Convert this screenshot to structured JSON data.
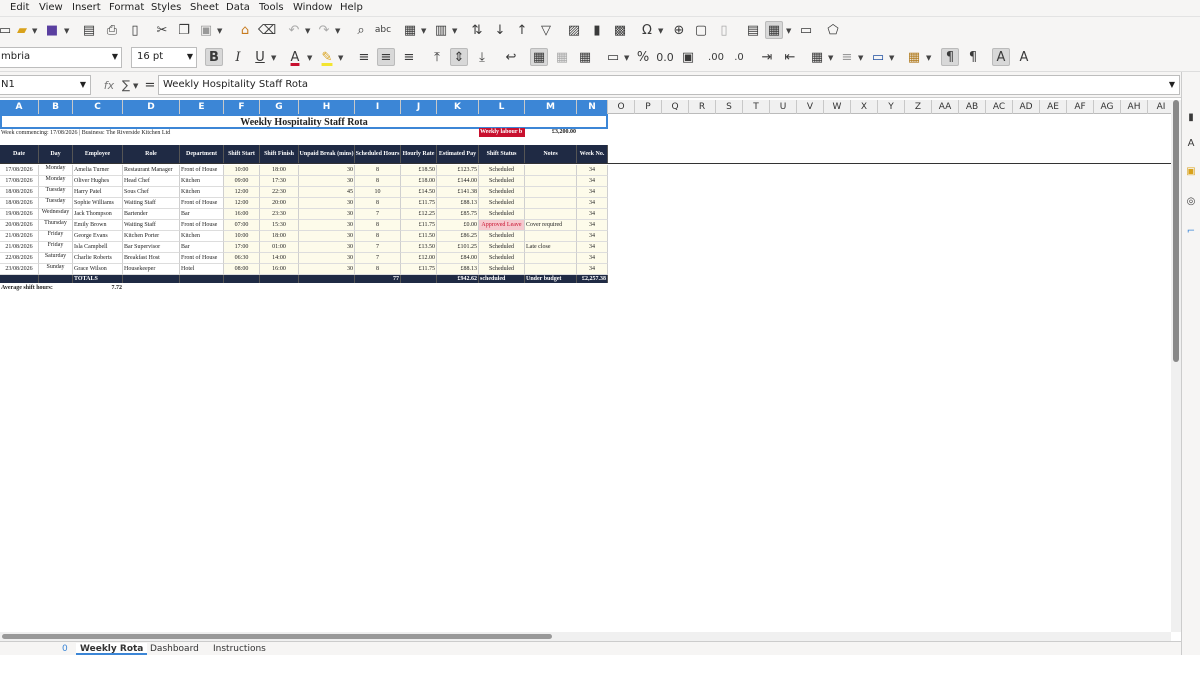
{
  "menu": [
    "Edit",
    "View",
    "Insert",
    "Format",
    "Styles",
    "Sheet",
    "Data",
    "Tools",
    "Window",
    "Help"
  ],
  "font": {
    "name": "mbria",
    "size": "16 pt"
  },
  "namebox": "N1",
  "formula_symbols": {
    "fx": "fx",
    "sigma": "∑",
    "eq": "="
  },
  "formula": "Weekly Hospitality Staff Rota",
  "columns": [
    "A",
    "B",
    "C",
    "D",
    "E",
    "F",
    "G",
    "H",
    "I",
    "J",
    "K",
    "L",
    "M",
    "N",
    "O",
    "P",
    "Q",
    "R",
    "S",
    "T",
    "U",
    "V",
    "W",
    "X",
    "Y",
    "Z",
    "AA",
    "AB",
    "AC",
    "AD",
    "AE",
    "AF",
    "AG",
    "AH",
    "AI"
  ],
  "rota": {
    "title": "Weekly Hospitality Staff Rota",
    "subtitle": "Week commencing: 17/08/2026 | Business: The Riverside Kitchen Ltd",
    "labour_label": "Weekly labour b",
    "labour_value": "£3,200.00",
    "headers": [
      "Date",
      "Day",
      "Employee",
      "Role",
      "Department",
      "Shift Start",
      "Shift Finish",
      "Unpaid Break (mins)",
      "Scheduled Hours",
      "Hourly Rate",
      "Estimated Pay",
      "Shift Status",
      "Notes",
      "Week No."
    ],
    "rows": [
      [
        "17/08/2026",
        "Monday",
        "Amelia Turner",
        "Restaurant Manager",
        "Front of House",
        "10:00",
        "18:00",
        "30",
        "8",
        "£18.50",
        "£123.75",
        "Scheduled",
        "",
        "34"
      ],
      [
        "17/08/2026",
        "Monday",
        "Oliver Hughes",
        "Head Chef",
        "Kitchen",
        "09:00",
        "17:30",
        "30",
        "8",
        "£18.00",
        "£144.00",
        "Scheduled",
        "",
        "34"
      ],
      [
        "18/08/2026",
        "Tuesday",
        "Harry Patel",
        "Sous Chef",
        "Kitchen",
        "12:00",
        "22:30",
        "45",
        "10",
        "£14.50",
        "£141.38",
        "Scheduled",
        "",
        "34"
      ],
      [
        "18/08/2026",
        "Tuesday",
        "Sophie Williams",
        "Waiting Staff",
        "Front of House",
        "12:00",
        "20:00",
        "30",
        "8",
        "£11.75",
        "£88.13",
        "Scheduled",
        "",
        "34"
      ],
      [
        "19/08/2026",
        "Wednesday",
        "Jack Thompson",
        "Bartender",
        "Bar",
        "16:00",
        "23:30",
        "30",
        "7",
        "£12.25",
        "£85.75",
        "Scheduled",
        "",
        "34"
      ],
      [
        "20/08/2026",
        "Thursday",
        "Emily Brown",
        "Waiting Staff",
        "Front of House",
        "07:00",
        "15:30",
        "30",
        "8",
        "£11.75",
        "£0.00",
        "Approved Leave",
        "Cover required",
        "34"
      ],
      [
        "21/08/2026",
        "Friday",
        "George Evans",
        "Kitchen Porter",
        "Kitchen",
        "10:00",
        "18:00",
        "30",
        "8",
        "£11.50",
        "£86.25",
        "Scheduled",
        "",
        "34"
      ],
      [
        "21/08/2026",
        "Friday",
        "Isla Campbell",
        "Bar Supervisor",
        "Bar",
        "17:00",
        "01:00",
        "30",
        "7",
        "£13.50",
        "£101.25",
        "Scheduled",
        "Late close",
        "34"
      ],
      [
        "22/08/2026",
        "Saturday",
        "Charlie Roberts",
        "Breakfast Host",
        "Front of House",
        "06:30",
        "14:00",
        "30",
        "7",
        "£12.00",
        "£84.00",
        "Scheduled",
        "",
        "34"
      ],
      [
        "23/08/2026",
        "Sunday",
        "Grace Wilson",
        "Housekeeper",
        "Hotel",
        "08:00",
        "16:00",
        "30",
        "8",
        "£11.75",
        "£88.13",
        "Scheduled",
        "",
        "34"
      ]
    ],
    "totals": {
      "label": "TOTALS",
      "hours": "77",
      "pay": "£942.62",
      "status": "scheduled",
      "notes": "Under budget",
      "week": "£2,257.38"
    },
    "avg_label": "Average shift hours:",
    "avg_value": "7.72"
  },
  "tabs": [
    "Weekly Rota",
    "Dashboard",
    "Instructions"
  ],
  "tab_index": "0",
  "colors": {
    "header": "#1f2a44",
    "accent": "#3c86d6",
    "leave": "#f6c9cf",
    "budget": "#c8102e"
  }
}
